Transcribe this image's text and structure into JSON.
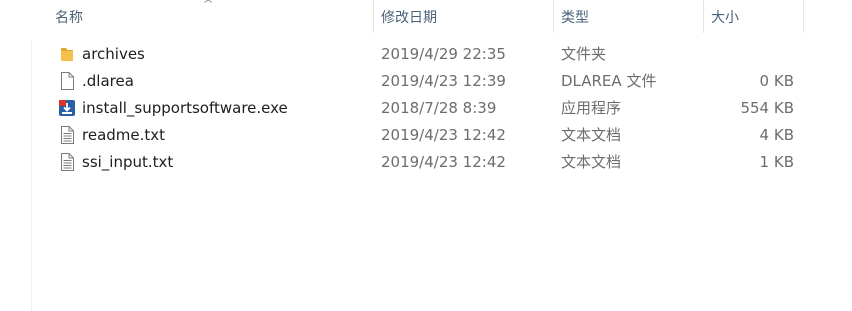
{
  "columns": {
    "name": "名称",
    "modified": "修改日期",
    "type": "类型",
    "size": "大小"
  },
  "files": [
    {
      "name": "archives",
      "modified": "2019/4/29 22:35",
      "type": "文件夹",
      "size": "",
      "icon": "folder-icon"
    },
    {
      "name": ".dlarea",
      "modified": "2019/4/23 12:39",
      "type": "DLAREA 文件",
      "size": "0 KB",
      "icon": "blank-file-icon"
    },
    {
      "name": "install_supportsoftware.exe",
      "modified": "2018/7/28 8:39",
      "type": "应用程序",
      "size": "554 KB",
      "icon": "installer-app-icon"
    },
    {
      "name": "readme.txt",
      "modified": "2019/4/23 12:42",
      "type": "文本文档",
      "size": "4 KB",
      "icon": "text-file-icon"
    },
    {
      "name": "ssi_input.txt",
      "modified": "2019/4/23 12:42",
      "type": "文本文档",
      "size": "1 KB",
      "icon": "text-file-icon"
    }
  ],
  "colors": {
    "header_text": "#4c607a",
    "folder": "#f4c14d",
    "installer_blue": "#2a5fa8",
    "installer_red": "#d8352b"
  }
}
